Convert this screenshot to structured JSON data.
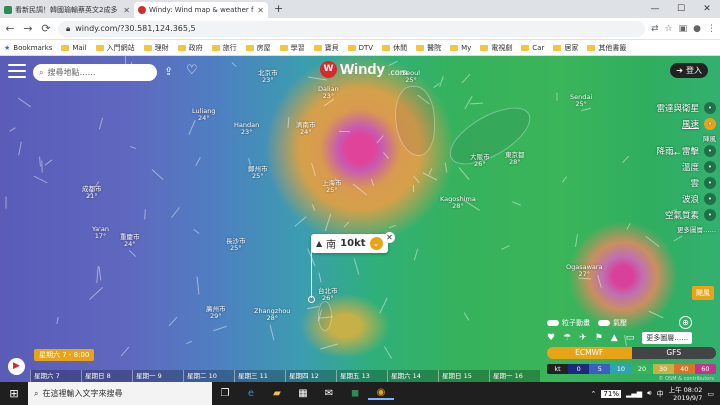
{
  "browser": {
    "tabs": [
      {
        "title": "看新民調！韓國瑜輸蔡英文2成多",
        "active": false,
        "color": "#2e8b57"
      },
      {
        "title": "Windy: Wind map & weather fore",
        "active": true,
        "color": "#d62b2b"
      }
    ],
    "new_tab": "+",
    "url": "windy.com/?30.581,124.365,5",
    "bookmarks": [
      "Bookmarks",
      "Mail",
      "入門網站",
      "理財",
      "政府",
      "旅行",
      "房屋",
      "學習",
      "寶貝",
      "DTV",
      "休閒",
      "醫院",
      "My",
      "電視劇",
      "Car",
      "居家",
      "其他書籤"
    ]
  },
  "windy": {
    "search_placeholder": "搜尋地點……",
    "logo": "Windy",
    "logo_suffix": ".com",
    "login": "登入",
    "layers": [
      {
        "label": "雷達與衛星",
        "icon": "radar-icon",
        "active": false
      },
      {
        "label": "風速",
        "icon": "wind-icon",
        "active": true
      },
      {
        "label": "陣風",
        "icon": "gust-icon",
        "active": false,
        "small": true
      },
      {
        "label": "降雨，雷擊",
        "icon": "rain-icon",
        "active": false
      },
      {
        "label": "溫度",
        "icon": "temperature-icon",
        "active": false
      },
      {
        "label": "雲",
        "icon": "cloud-icon",
        "active": false
      },
      {
        "label": "波浪",
        "icon": "wave-icon",
        "active": false
      },
      {
        "label": "空氣質素",
        "icon": "air-icon",
        "active": false
      },
      {
        "label": "更多圖層……",
        "icon": "more-icon",
        "active": false,
        "small": true
      }
    ],
    "wind_popup": {
      "direction": "南",
      "speed": "10kt"
    },
    "hurricane_btn": "颶風",
    "toggles": [
      {
        "label": "粒子動畫"
      },
      {
        "label": "氣壓"
      }
    ],
    "more_products": "更多圖層……",
    "models": [
      {
        "name": "ECMWF",
        "active": true
      },
      {
        "name": "GFS",
        "active": false
      }
    ],
    "legend": {
      "unit": "kt",
      "stops": [
        "0",
        "5",
        "10",
        "20",
        "30",
        "40",
        "60"
      ],
      "colors": [
        "#1b2a7a",
        "#3b5fc0",
        "#2fa3b0",
        "#36b25c",
        "#c8b048",
        "#d6762e",
        "#c0368a",
        "#9b2c9b"
      ]
    },
    "time_bubble": "星期六 7 - 8:00",
    "days": [
      "星期六 7",
      "星期日 8",
      "星期一 9",
      "星期二 10",
      "星期三 11",
      "星期四 12",
      "星期五 13",
      "星期六 14",
      "星期日 15",
      "星期一 16"
    ],
    "attribution": "© OSM & contributors",
    "cities": [
      {
        "name": "北京市",
        "temp": "23°"
      },
      {
        "name": "Dalian",
        "temp": "23°"
      },
      {
        "name": "Seoul",
        "temp": "25°"
      },
      {
        "name": "Sendai",
        "temp": "25°"
      },
      {
        "name": "Handan",
        "temp": "23°"
      },
      {
        "name": "濟南市",
        "temp": "24°"
      },
      {
        "name": "Luliang",
        "temp": "24°"
      },
      {
        "name": "鄭州市",
        "temp": "25°"
      },
      {
        "name": "大阪市",
        "temp": "26°"
      },
      {
        "name": "東京都",
        "temp": "28°"
      },
      {
        "name": "Kagoshima",
        "temp": "28°"
      },
      {
        "name": "上海市",
        "temp": "25°"
      },
      {
        "name": "長沙市",
        "temp": "25°"
      },
      {
        "name": "Ogasawara",
        "temp": "27°"
      },
      {
        "name": "台北市",
        "temp": "26°"
      },
      {
        "name": "廣州市",
        "temp": "29°"
      },
      {
        "name": "Zhangzhou",
        "temp": "28°"
      },
      {
        "name": "成都市",
        "temp": "21°"
      },
      {
        "name": "重慶市",
        "temp": "24°"
      },
      {
        "name": "Ya'an",
        "temp": "17°"
      }
    ]
  },
  "taskbar": {
    "search_placeholder": "在這裡輸入文字來搜尋",
    "battery": "71%",
    "clock_time": "上午 08:02",
    "clock_date": "2019/9/7",
    "lang": "中"
  }
}
